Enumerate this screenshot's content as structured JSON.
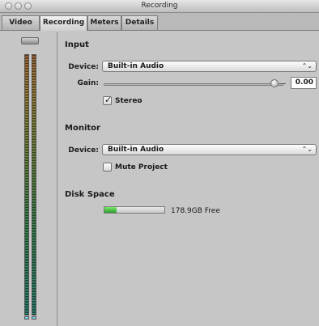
{
  "window": {
    "title": "Recording"
  },
  "tabs": [
    {
      "label": "Video",
      "active": false
    },
    {
      "label": "Recording",
      "active": true
    },
    {
      "label": "Meters",
      "active": false
    },
    {
      "label": "Details",
      "active": false
    }
  ],
  "input": {
    "section_title": "Input",
    "device_label": "Device:",
    "device_value": "Built-in Audio",
    "gain_label": "Gain:",
    "gain_value": "0.00",
    "stereo_label": "Stereo",
    "stereo_checked": true
  },
  "monitor": {
    "section_title": "Monitor",
    "device_label": "Device:",
    "device_value": "Built-in Audio",
    "mute_label": "Mute Project",
    "mute_checked": false
  },
  "disk": {
    "section_title": "Disk Space",
    "free_text": "178.9GB Free",
    "used_fraction": 0.2
  },
  "icons": {
    "popup_arrows": "⌃⌄",
    "checkmark": "✓"
  },
  "colors": {
    "background": "#c6c6c6",
    "meter_top": "#b0733b",
    "meter_bottom": "#2d8b78",
    "progress_fill": "#2c9b2c"
  }
}
